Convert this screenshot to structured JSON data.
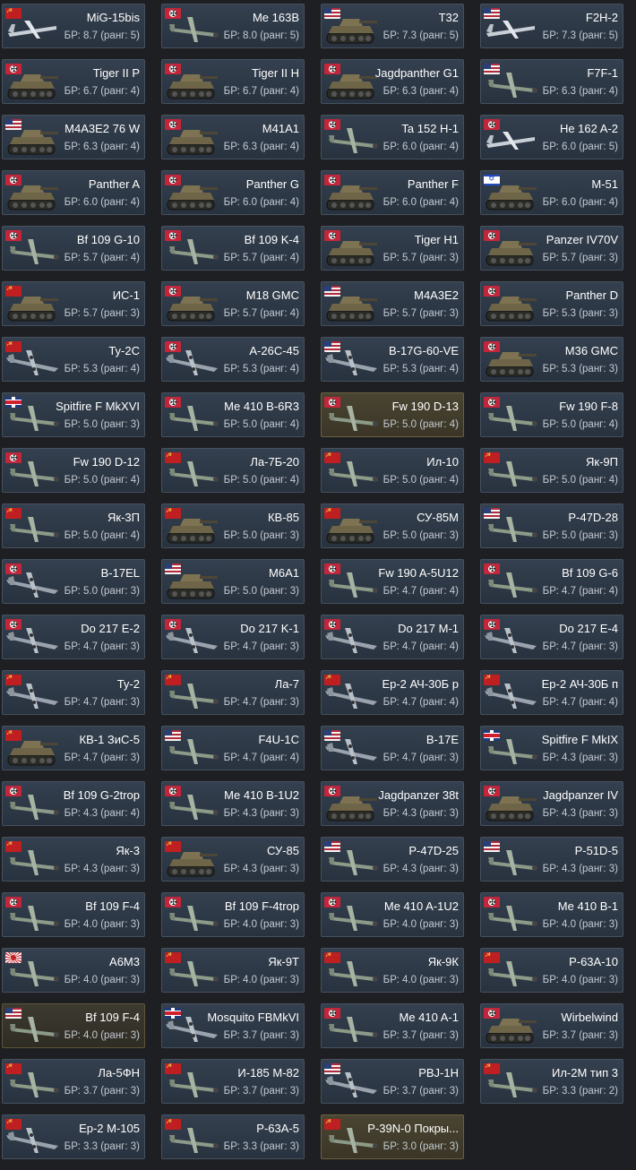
{
  "vehicles": [
    {
      "name": "MiG-15bis",
      "br": "БР: 8.7 (ранг: 5)",
      "flag": "ussr",
      "kind": "jet"
    },
    {
      "name": "Me 163B",
      "br": "БР: 8.0 (ранг: 5)",
      "flag": "de",
      "kind": "plane"
    },
    {
      "name": "T32",
      "br": "БР: 7.3 (ранг: 5)",
      "flag": "us",
      "kind": "tank"
    },
    {
      "name": "F2H-2",
      "br": "БР: 7.3 (ранг: 5)",
      "flag": "us",
      "kind": "jet"
    },
    {
      "name": "Tiger II P",
      "br": "БР: 6.7 (ранг: 4)",
      "flag": "de",
      "kind": "tank"
    },
    {
      "name": "Tiger II H",
      "br": "БР: 6.7 (ранг: 4)",
      "flag": "de",
      "kind": "tank"
    },
    {
      "name": "Jagdpanther G1",
      "br": "БР: 6.3 (ранг: 4)",
      "flag": "de",
      "kind": "tank"
    },
    {
      "name": "F7F-1",
      "br": "БР: 6.3 (ранг: 4)",
      "flag": "us",
      "kind": "plane"
    },
    {
      "name": "M4A3E2 76 W",
      "br": "БР: 6.3 (ранг: 4)",
      "flag": "us",
      "kind": "tank"
    },
    {
      "name": "M41A1",
      "br": "БР: 6.3 (ранг: 4)",
      "flag": "de",
      "kind": "tank"
    },
    {
      "name": "Ta 152 H-1",
      "br": "БР: 6.0 (ранг: 4)",
      "flag": "de",
      "kind": "plane"
    },
    {
      "name": "He 162 A-2",
      "br": "БР: 6.0 (ранг: 5)",
      "flag": "de",
      "kind": "jet"
    },
    {
      "name": "Panther A",
      "br": "БР: 6.0 (ранг: 4)",
      "flag": "de",
      "kind": "tank"
    },
    {
      "name": "Panther G",
      "br": "БР: 6.0 (ранг: 4)",
      "flag": "de",
      "kind": "tank"
    },
    {
      "name": "Panther F",
      "br": "БР: 6.0 (ранг: 4)",
      "flag": "de",
      "kind": "tank"
    },
    {
      "name": "M-51",
      "br": "БР: 6.0 (ранг: 4)",
      "flag": "il",
      "kind": "tank"
    },
    {
      "name": "Bf 109 G-10",
      "br": "БР: 5.7 (ранг: 4)",
      "flag": "de",
      "kind": "plane"
    },
    {
      "name": "Bf 109 K-4",
      "br": "БР: 5.7 (ранг: 4)",
      "flag": "de",
      "kind": "plane"
    },
    {
      "name": "Tiger H1",
      "br": "БР: 5.7 (ранг: 3)",
      "flag": "de",
      "kind": "tank"
    },
    {
      "name": "Panzer IV70V",
      "br": "БР: 5.7 (ранг: 3)",
      "flag": "de",
      "kind": "tank"
    },
    {
      "name": "ИС-1",
      "br": "БР: 5.7 (ранг: 3)",
      "flag": "ussr",
      "kind": "tank"
    },
    {
      "name": "M18 GMC",
      "br": "БР: 5.7 (ранг: 4)",
      "flag": "de",
      "kind": "tank"
    },
    {
      "name": "M4A3E2",
      "br": "БР: 5.7 (ранг: 3)",
      "flag": "us",
      "kind": "tank"
    },
    {
      "name": "Panther D",
      "br": "БР: 5.3 (ранг: 3)",
      "flag": "de",
      "kind": "tank"
    },
    {
      "name": "Ту-2С",
      "br": "БР: 5.3 (ранг: 4)",
      "flag": "ussr",
      "kind": "bomber"
    },
    {
      "name": "A-26C-45",
      "br": "БР: 5.3 (ранг: 4)",
      "flag": "de",
      "kind": "bomber"
    },
    {
      "name": "B-17G-60-VE",
      "br": "БР: 5.3 (ранг: 4)",
      "flag": "us",
      "kind": "bomber"
    },
    {
      "name": "M36 GMC",
      "br": "БР: 5.3 (ранг: 3)",
      "flag": "de",
      "kind": "tank"
    },
    {
      "name": "Spitfire F MkXVI",
      "br": "БР: 5.0 (ранг: 3)",
      "flag": "uk",
      "kind": "plane"
    },
    {
      "name": "Me 410 B-6R3",
      "br": "БР: 5.0 (ранг: 4)",
      "flag": "de",
      "kind": "plane"
    },
    {
      "name": "Fw 190 D-13",
      "br": "БР: 5.0 (ранг: 4)",
      "flag": "de",
      "kind": "plane",
      "style": "gold"
    },
    {
      "name": "Fw 190 F-8",
      "br": "БР: 5.0 (ранг: 4)",
      "flag": "de",
      "kind": "plane"
    },
    {
      "name": "Fw 190 D-12",
      "br": "БР: 5.0 (ранг: 4)",
      "flag": "de",
      "kind": "plane"
    },
    {
      "name": "Ла-7Б-20",
      "br": "БР: 5.0 (ранг: 4)",
      "flag": "ussr",
      "kind": "plane"
    },
    {
      "name": "Ил-10",
      "br": "БР: 5.0 (ранг: 4)",
      "flag": "ussr",
      "kind": "plane"
    },
    {
      "name": "Як-9П",
      "br": "БР: 5.0 (ранг: 4)",
      "flag": "ussr",
      "kind": "plane"
    },
    {
      "name": "Як-3П",
      "br": "БР: 5.0 (ранг: 4)",
      "flag": "ussr",
      "kind": "plane"
    },
    {
      "name": "КВ-85",
      "br": "БР: 5.0 (ранг: 3)",
      "flag": "ussr",
      "kind": "tank"
    },
    {
      "name": "СУ-85М",
      "br": "БР: 5.0 (ранг: 3)",
      "flag": "ussr",
      "kind": "tank"
    },
    {
      "name": "P-47D-28",
      "br": "БР: 5.0 (ранг: 3)",
      "flag": "us",
      "kind": "plane"
    },
    {
      "name": "B-17EL",
      "br": "БР: 5.0 (ранг: 3)",
      "flag": "de",
      "kind": "bomber"
    },
    {
      "name": "M6A1",
      "br": "БР: 5.0 (ранг: 3)",
      "flag": "us",
      "kind": "tank"
    },
    {
      "name": "Fw 190 A-5U12",
      "br": "БР: 4.7 (ранг: 4)",
      "flag": "de",
      "kind": "plane"
    },
    {
      "name": "Bf 109 G-6",
      "br": "БР: 4.7 (ранг: 4)",
      "flag": "de",
      "kind": "plane"
    },
    {
      "name": "Do 217 E-2",
      "br": "БР: 4.7 (ранг: 3)",
      "flag": "de",
      "kind": "bomber"
    },
    {
      "name": "Do 217 K-1",
      "br": "БР: 4.7 (ранг: 3)",
      "flag": "de",
      "kind": "bomber"
    },
    {
      "name": "Do 217 M-1",
      "br": "БР: 4.7 (ранг: 4)",
      "flag": "de",
      "kind": "bomber"
    },
    {
      "name": "Do 217 E-4",
      "br": "БР: 4.7 (ранг: 3)",
      "flag": "de",
      "kind": "bomber"
    },
    {
      "name": "Ту-2",
      "br": "БР: 4.7 (ранг: 3)",
      "flag": "ussr",
      "kind": "bomber"
    },
    {
      "name": "Ла-7",
      "br": "БР: 4.7 (ранг: 3)",
      "flag": "ussr",
      "kind": "plane"
    },
    {
      "name": "Ер-2 АЧ-30Б р",
      "br": "БР: 4.7 (ранг: 4)",
      "flag": "ussr",
      "kind": "bomber"
    },
    {
      "name": "Ер-2 АЧ-30Б п",
      "br": "БР: 4.7 (ранг: 4)",
      "flag": "ussr",
      "kind": "bomber"
    },
    {
      "name": "КВ-1 ЗиС-5",
      "br": "БР: 4.7 (ранг: 3)",
      "flag": "ussr",
      "kind": "tank"
    },
    {
      "name": "F4U-1C",
      "br": "БР: 4.7 (ранг: 4)",
      "flag": "us",
      "kind": "plane"
    },
    {
      "name": "B-17E",
      "br": "БР: 4.7 (ранг: 3)",
      "flag": "us",
      "kind": "bomber"
    },
    {
      "name": "Spitfire F MkIX",
      "br": "БР: 4.3 (ранг: 3)",
      "flag": "uk",
      "kind": "plane"
    },
    {
      "name": "Bf 109 G-2trop",
      "br": "БР: 4.3 (ранг: 4)",
      "flag": "de",
      "kind": "plane"
    },
    {
      "name": "Me 410 B-1U2",
      "br": "БР: 4.3 (ранг: 3)",
      "flag": "de",
      "kind": "plane"
    },
    {
      "name": "Jagdpanzer 38t",
      "br": "БР: 4.3 (ранг: 3)",
      "flag": "de",
      "kind": "tank"
    },
    {
      "name": "Jagdpanzer IV",
      "br": "БР: 4.3 (ранг: 3)",
      "flag": "de",
      "kind": "tank"
    },
    {
      "name": "Як-3",
      "br": "БР: 4.3 (ранг: 3)",
      "flag": "ussr",
      "kind": "plane"
    },
    {
      "name": "СУ-85",
      "br": "БР: 4.3 (ранг: 3)",
      "flag": "ussr",
      "kind": "tank"
    },
    {
      "name": "P-47D-25",
      "br": "БР: 4.3 (ранг: 3)",
      "flag": "us",
      "kind": "plane"
    },
    {
      "name": "P-51D-5",
      "br": "БР: 4.3 (ранг: 3)",
      "flag": "us",
      "kind": "plane"
    },
    {
      "name": "Bf 109 F-4",
      "br": "БР: 4.0 (ранг: 3)",
      "flag": "de",
      "kind": "plane"
    },
    {
      "name": "Bf 109 F-4trop",
      "br": "БР: 4.0 (ранг: 3)",
      "flag": "de",
      "kind": "plane"
    },
    {
      "name": "Me 410 A-1U2",
      "br": "БР: 4.0 (ранг: 3)",
      "flag": "de",
      "kind": "plane"
    },
    {
      "name": "Me 410 B-1",
      "br": "БР: 4.0 (ранг: 3)",
      "flag": "de",
      "kind": "plane"
    },
    {
      "name": "A6M3",
      "br": "БР: 4.0 (ранг: 3)",
      "flag": "jp",
      "kind": "plane"
    },
    {
      "name": "Як-9Т",
      "br": "БР: 4.0 (ранг: 3)",
      "flag": "ussr",
      "kind": "plane"
    },
    {
      "name": "Як-9К",
      "br": "БР: 4.0 (ранг: 3)",
      "flag": "ussr",
      "kind": "plane"
    },
    {
      "name": "P-63A-10",
      "br": "БР: 4.0 (ранг: 3)",
      "flag": "ussr",
      "kind": "plane"
    },
    {
      "name": "Bf 109 F-4",
      "br": "БР: 4.0 (ранг: 3)",
      "flag": "us",
      "kind": "plane",
      "style": "prem"
    },
    {
      "name": "Mosquito FBMkVI",
      "br": "БР: 3.7 (ранг: 3)",
      "flag": "uk",
      "kind": "bomber"
    },
    {
      "name": "Me 410 A-1",
      "br": "БР: 3.7 (ранг: 3)",
      "flag": "de",
      "kind": "plane"
    },
    {
      "name": "Wirbelwind",
      "br": "БР: 3.7 (ранг: 3)",
      "flag": "de",
      "kind": "tank"
    },
    {
      "name": "Ла-5ФН",
      "br": "БР: 3.7 (ранг: 3)",
      "flag": "ussr",
      "kind": "plane"
    },
    {
      "name": "И-185 М-82",
      "br": "БР: 3.7 (ранг: 3)",
      "flag": "ussr",
      "kind": "plane"
    },
    {
      "name": "PBJ-1H",
      "br": "БР: 3.7 (ранг: 3)",
      "flag": "us",
      "kind": "bomber"
    },
    {
      "name": "Ил-2М тип 3",
      "br": "БР: 3.3 (ранг: 2)",
      "flag": "ussr",
      "kind": "plane"
    },
    {
      "name": "Ер-2 М-105",
      "br": "БР: 3.3 (ранг: 3)",
      "flag": "ussr",
      "kind": "bomber"
    },
    {
      "name": "P-63A-5",
      "br": "БР: 3.3 (ранг: 3)",
      "flag": "ussr",
      "kind": "plane"
    },
    {
      "name": "P-39N-0 Покры...",
      "br": "БР: 3.0 (ранг: 3)",
      "flag": "ussr",
      "kind": "plane",
      "style": "gold"
    }
  ]
}
